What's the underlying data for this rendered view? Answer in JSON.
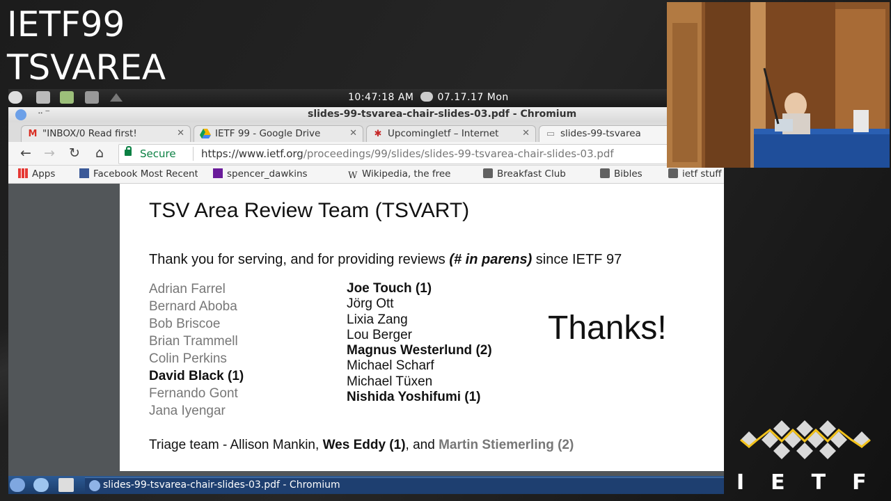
{
  "event": {
    "line1": "IETF99",
    "line2": "TSVAREA"
  },
  "system_panel": {
    "time": "10:47:18 AM",
    "date": "07.17.17 Mon"
  },
  "window": {
    "title": "slides-99-tsvarea-chair-slides-03.pdf - Chromium"
  },
  "tabs": [
    {
      "label": "\"INBOX/0 Read first!",
      "icon": "gmail-icon",
      "close": "✕"
    },
    {
      "label": "IETF 99 - Google Drive",
      "icon": "google-drive-icon",
      "close": "✕"
    },
    {
      "label": "UpcomingIetf – Internet",
      "icon": "ietf-tab-icon",
      "close": "✕"
    },
    {
      "label": "slides-99-tsvarea",
      "icon": "document-icon",
      "close": ""
    }
  ],
  "toolbar": {
    "secure_label": "Secure",
    "url_host": "https://www.ietf.org",
    "url_path": "/proceedings/99/slides/slides-99-tsvarea-chair-slides-03.pdf"
  },
  "bookmarks": [
    {
      "label": "Apps",
      "icon": "apps-grid-icon"
    },
    {
      "label": "Facebook Most Recent",
      "icon": "facebook-icon"
    },
    {
      "label": "spencer_dawkins",
      "icon": "mail-icon"
    },
    {
      "label": "Wikipedia, the free",
      "icon": "wikipedia-icon"
    },
    {
      "label": "Breakfast Club",
      "icon": "folder-icon"
    },
    {
      "label": "Bibles",
      "icon": "folder-icon"
    },
    {
      "label": "ietf stuff",
      "icon": "folder-icon"
    }
  ],
  "slide": {
    "title": "TSV Area Review Team (TSVART)",
    "intro_before": "Thank you for serving, and for providing reviews ",
    "intro_emph": "(# in parens)",
    "intro_after": " since IETF 97",
    "col1": [
      {
        "name": "Adrian Farrel",
        "bold": false
      },
      {
        "name": "Bernard Aboba",
        "bold": false
      },
      {
        "name": "Bob Briscoe",
        "bold": false
      },
      {
        "name": "Brian Trammell",
        "bold": false
      },
      {
        "name": "Colin Perkins",
        "bold": false
      },
      {
        "name": "David Black (1)",
        "bold": true
      },
      {
        "name": "Fernando Gont",
        "bold": false
      },
      {
        "name": "Jana Iyengar",
        "bold": false
      }
    ],
    "col2": [
      {
        "name": "Joe Touch (1)",
        "bold": true
      },
      {
        "name": "Jörg Ott",
        "bold": false
      },
      {
        "name": "Lixia Zang",
        "bold": false
      },
      {
        "name": "Lou Berger",
        "bold": false
      },
      {
        "name": "Magnus Westerlund (2)",
        "bold": true
      },
      {
        "name": "Michael Scharf",
        "bold": false
      },
      {
        "name": "Michael Tüxen",
        "bold": false
      },
      {
        "name": "Nishida Yoshifumi (1)",
        "bold": true
      }
    ],
    "thanks": "Thanks!",
    "triage_prefix": "Triage team - Allison Mankin, ",
    "triage_bold": "Wes Eddy (1)",
    "triage_mid": ", and ",
    "triage_grey": "Martin Stiemerling (2)"
  },
  "taskbar": {
    "task_label": "slides-99-tsvarea-chair-slides-03.pdf - Chromium"
  },
  "logo": {
    "text": "IETF"
  }
}
